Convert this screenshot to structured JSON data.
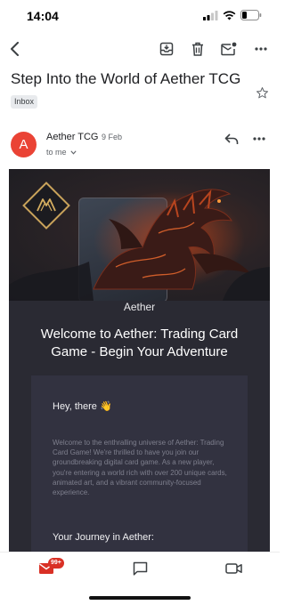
{
  "status_bar": {
    "time": "14:04"
  },
  "email": {
    "subject": "Step Into the World of Aether TCG",
    "label": "Inbox",
    "sender": {
      "avatar_letter": "A",
      "name": "Aether TCG",
      "date": "9 Feb",
      "recipient": "to me",
      "avatar_color": "#ea4335"
    }
  },
  "body": {
    "brand": "Aether",
    "headline": "Welcome to Aether: Trading Card Game - Begin Your Adventure",
    "greeting": "Hey, there 👋",
    "intro": "Welcome to the enthralling universe of Aether: Trading Card Game! We're thrilled to have you join our groundbreaking digital card game. As a new player, you're entering a world rich with over 200 unique cards, animated art, and a vibrant community-focused experience.",
    "section_heading": "Your Journey in Aether:"
  },
  "bottom_nav": {
    "mail_badge": "99+"
  },
  "colors": {
    "accent_red": "#d93025",
    "email_bg": "#2a2a33",
    "gold": "#c9a35b"
  },
  "icons": {
    "toolbar": [
      "back-arrow-icon",
      "archive-icon",
      "trash-icon",
      "mark-unread-icon",
      "more-vert-icon"
    ],
    "bottom_nav": [
      "mail-icon",
      "chat-icon",
      "video-icon"
    ]
  }
}
